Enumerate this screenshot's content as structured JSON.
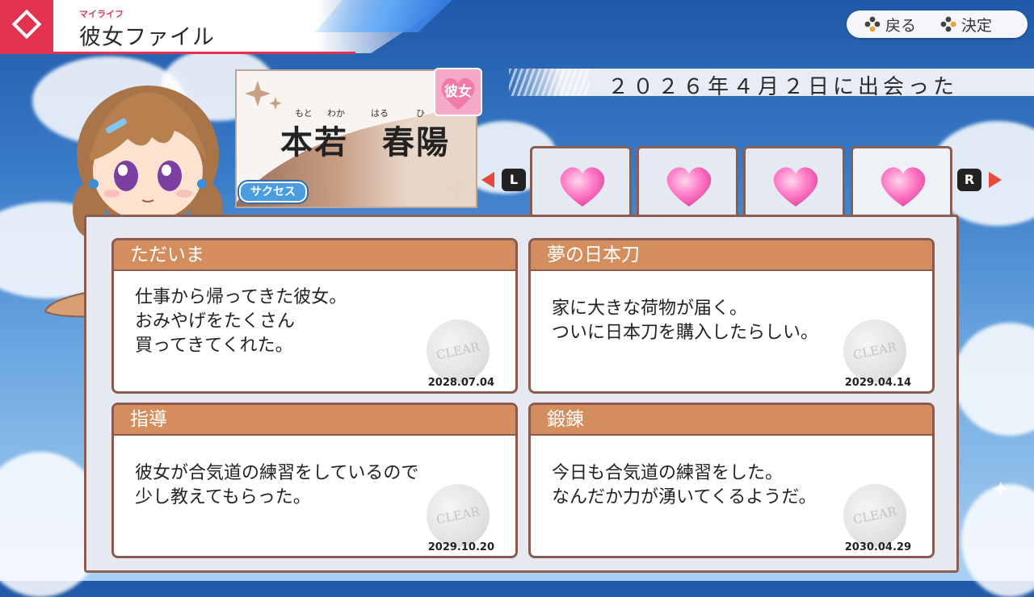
{
  "header": {
    "subtitle": "マイライフ",
    "title": "彼女ファイル"
  },
  "controls": {
    "back_label": "戻る",
    "confirm_label": "決定"
  },
  "met_date": "２０２６年４月２日に出会った",
  "profile": {
    "ruby_hon": "もと",
    "ruby_waka": "わか",
    "ruby_haru": "はる",
    "ruby_hi": "ひ",
    "name": "本若　春陽",
    "badge": "彼女",
    "logo": "サクセス"
  },
  "nav": {
    "left_key": "L",
    "right_key": "R"
  },
  "tabs": [
    {
      "icon": "heart-icon",
      "active": false
    },
    {
      "icon": "heart-icon",
      "active": false
    },
    {
      "icon": "heart-icon",
      "active": false
    },
    {
      "icon": "heart-icon",
      "active": true
    }
  ],
  "events": [
    {
      "title": "ただいま",
      "body": "仕事から帰ってきた彼女。\nおみやげをたくさん\n買ってきてくれた。",
      "date": "2028.07.04",
      "stamp": "CLEAR"
    },
    {
      "title": "夢の日本刀",
      "body": "家に大きな荷物が届く。\nついに日本刀を購入したらしい。",
      "date": "2029.04.14",
      "stamp": "CLEAR"
    },
    {
      "title": "指導",
      "body": "彼女が合気道の練習をしているので\n少し教えてもらった。",
      "date": "2029.10.20",
      "stamp": "CLEAR"
    },
    {
      "title": "鍛錬",
      "body": "今日も合気道の練習をした。\nなんだか力が湧いてくるようだ。",
      "date": "2030.04.29",
      "stamp": "CLEAR"
    }
  ]
}
